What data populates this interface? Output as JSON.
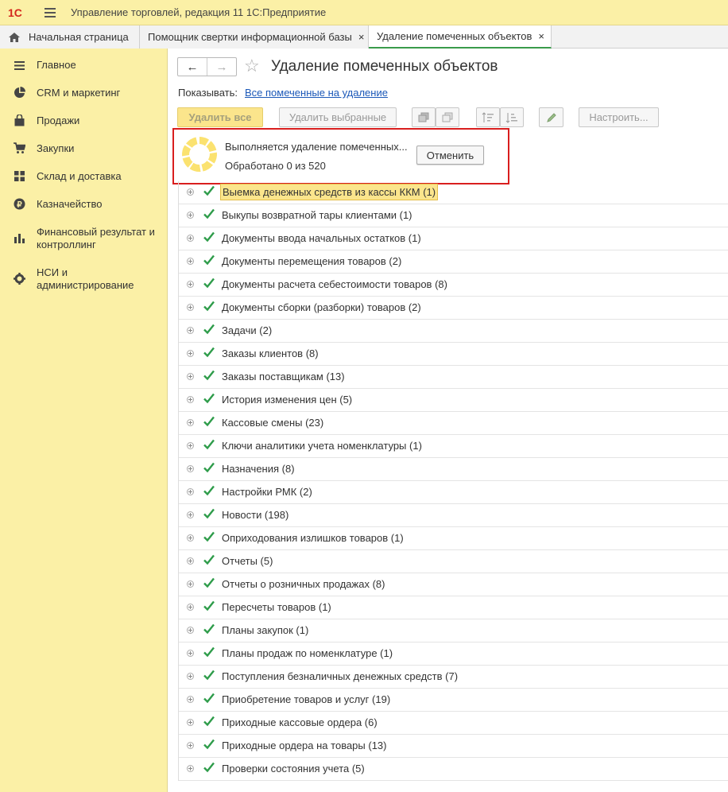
{
  "app": {
    "title": "Управление торговлей, редакция 11 1С:Предприятие",
    "logo_text": "1С",
    "colors": {
      "accent": "#fbf0a6",
      "brand_red": "#d4271d",
      "check_green": "#2e9c4a",
      "link": "#1b58b8"
    }
  },
  "tabs": [
    {
      "label": "Начальная страница",
      "icon": "home-icon"
    },
    {
      "label": "Помощник свертки информационной базы",
      "close": "×"
    },
    {
      "label": "Удаление помеченных объектов",
      "close": "×",
      "active": true
    }
  ],
  "sidebar": {
    "items": [
      {
        "label": "Главное",
        "icon": "list-icon"
      },
      {
        "label": "CRM и маркетинг",
        "icon": "pie-chart-icon"
      },
      {
        "label": "Продажи",
        "icon": "shopping-bag-icon"
      },
      {
        "label": "Закупки",
        "icon": "cart-icon"
      },
      {
        "label": "Склад и доставка",
        "icon": "grid-icon"
      },
      {
        "label": "Казначейство",
        "icon": "ruble-coin-icon"
      },
      {
        "label": "Финансовый результат и контроллинг",
        "icon": "bar-chart-icon"
      },
      {
        "label": "НСИ и администрирование",
        "icon": "gear-icon"
      }
    ]
  },
  "main": {
    "nav": {
      "back": "←",
      "forward": "→"
    },
    "title": "Удаление помеченных объектов",
    "show_label": "Показывать:",
    "show_link": "Все помеченные на удаление",
    "toolbar": {
      "delete_all": "Удалить все",
      "delete_selected": "Удалить выбранные",
      "configure": "Настроить..."
    },
    "progress": {
      "text": "Выполняется удаление помеченных...",
      "count": "Обработано 0 из 520",
      "processed": 0,
      "total": 520,
      "cancel": "Отменить"
    },
    "items": [
      "Выемка денежных средств из кассы ККМ (1)",
      "Выкупы возвратной тары клиентами (1)",
      "Документы ввода начальных остатков (1)",
      "Документы перемещения товаров (2)",
      "Документы расчета себестоимости товаров (8)",
      "Документы сборки (разборки) товаров (2)",
      "Задачи (2)",
      "Заказы клиентов (8)",
      "Заказы поставщикам (13)",
      "История изменения цен (5)",
      "Кассовые смены (23)",
      "Ключи аналитики учета номенклатуры (1)",
      "Назначения (8)",
      "Настройки РМК (2)",
      "Новости (198)",
      "Оприходования излишков товаров (1)",
      "Отчеты (5)",
      "Отчеты о розничных продажах (8)",
      "Пересчеты товаров (1)",
      "Планы закупок (1)",
      "Планы продаж по номенклатуре (1)",
      "Поступления безналичных денежных средств (7)",
      "Приобретение товаров и услуг (19)",
      "Приходные кассовые ордера (6)",
      "Приходные ордера на товары (13)",
      "Проверки состояния учета (5)"
    ]
  }
}
